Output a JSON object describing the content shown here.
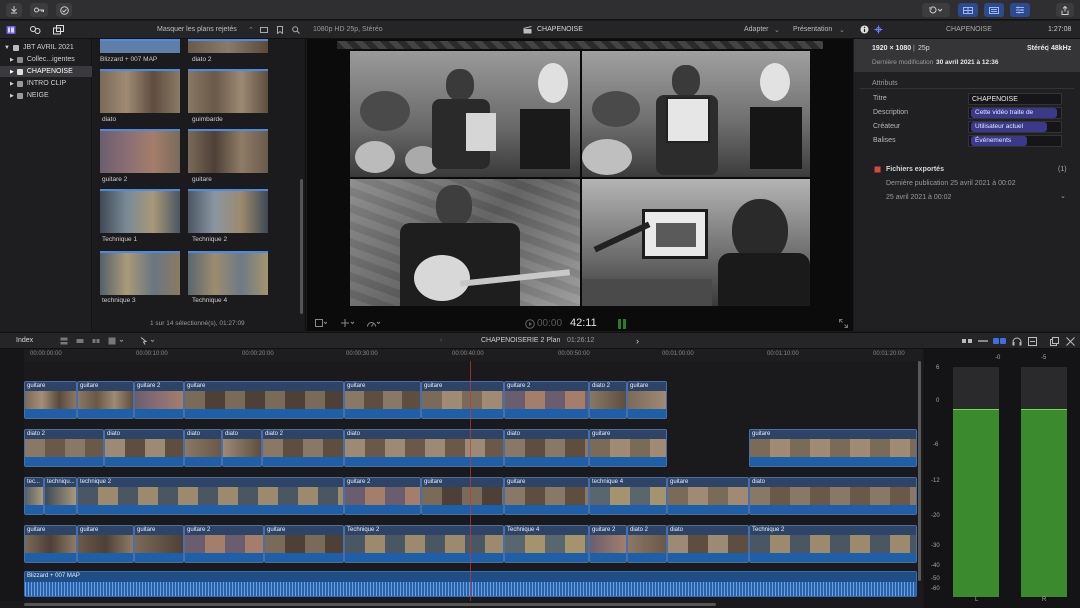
{
  "toolbar": {
    "left_icons": [
      "import-icon",
      "key-icon",
      "checkmark-icon"
    ],
    "right_icons": [
      "rotate-icon",
      "browser-layout-icon",
      "timeline-layout-icon",
      "inspector-layout-icon",
      "share-icon"
    ]
  },
  "browser_bar": {
    "filter_label": "Masquer les plans rejetés",
    "icons": [
      "film-icon",
      "tag-icon",
      "search-icon"
    ]
  },
  "viewer_bar": {
    "format": "1080p HD 25p, Stéréo",
    "title": "CHAPENOISE",
    "adapt_label": "Adapter",
    "presentation_label": "Présentation"
  },
  "inspector_bar": {
    "title": "CHAPENOISE",
    "duration": "1:27:08"
  },
  "libraries": [
    {
      "label": "JBT AVRIL 2021",
      "selected": false
    },
    {
      "label": "Collec...igentes",
      "selected": false
    },
    {
      "label": "CHAPENOISE",
      "selected": true
    },
    {
      "label": "INTRO CLIP",
      "selected": false
    },
    {
      "label": "NEIGE",
      "selected": false
    }
  ],
  "browser": {
    "clips": [
      {
        "label": "Blizzard + 007 MAP"
      },
      {
        "label": "diato 2"
      },
      {
        "label": "diato"
      },
      {
        "label": "guimbarde"
      },
      {
        "label": "guitare 2"
      },
      {
        "label": "guitare"
      },
      {
        "label": "Technique 1"
      },
      {
        "label": "Technique 2"
      },
      {
        "label": "technique 3"
      },
      {
        "label": "Technique 4"
      }
    ],
    "status": "1 sur 14 sélectionné(s), 01:27:09"
  },
  "viewer": {
    "timecode_dim": "00:00",
    "timecode": "42:11"
  },
  "inspector": {
    "resolution": "1920 × 1080",
    "framerate": "25p",
    "audio": "Stéréo",
    "samplerate": "48kHz",
    "last_modified_label": "Dernière modification",
    "last_modified_value": "30 avril 2021 à 12:36",
    "section": "Attributs",
    "rows": [
      {
        "key": "Titre",
        "value": "CHAPENOISE",
        "pill": false
      },
      {
        "key": "Description",
        "value": "Cette vidéo traite de",
        "pill": true
      },
      {
        "key": "Créateur",
        "value": "Utilisateur actuel",
        "pill": true
      },
      {
        "key": "Balises",
        "value": "Événements",
        "pill": true
      }
    ],
    "exports_title": "Fichiers exportés",
    "exports_count": "(1)",
    "last_publish": "Dernière publication 25 avril 2021 à 00:02",
    "publish_date": "25 avril 2021 à 00:02"
  },
  "timeline_bar": {
    "index_label": "Index",
    "project": "CHAPENOISERIE 2 Plan",
    "duration": "01:26:12"
  },
  "ruler": [
    "00:00:00:00",
    "00:00:10:00",
    "00:00:20:00",
    "00:00:30:00",
    "00:00:40:00",
    "00:00:50:00",
    "00:01:00:00",
    "00:01:10:00",
    "00:01:20:00"
  ],
  "tracks": [
    [
      "guitare",
      "guitare",
      "guitare 2",
      "guitare",
      "guitare",
      "guitare",
      "guitare 2",
      "diato 2",
      "guitare"
    ],
    [
      "diato 2",
      "diato",
      "diato",
      "diato",
      "diato 2",
      "diato",
      "diato",
      "guitare",
      "guitare"
    ],
    [
      "tec...",
      "techniqu...",
      "technique 2",
      "guitare 2",
      "guitare",
      "guitare",
      "technique 4",
      "guitare",
      "diato"
    ],
    [
      "guitare",
      "guitare",
      "guitare",
      "guitare 2",
      "guitare",
      "Technique 2",
      "Technique 4",
      "guitare 2",
      "diato 2",
      "diato",
      "Technique 2"
    ]
  ],
  "audio_track_label": "Blizzard + 007 MAP",
  "meters": {
    "scale": [
      "6",
      "0",
      "-6",
      "-12",
      "-20",
      "-30",
      "-40",
      "-50",
      "-60"
    ],
    "peaks": [
      "-0",
      "-5"
    ],
    "channels": [
      "L",
      "R"
    ],
    "level_db": -6
  },
  "colors": {
    "accent": "#4d8be0",
    "pill": "#3b3a8a",
    "playhead": "#c43a2c"
  }
}
